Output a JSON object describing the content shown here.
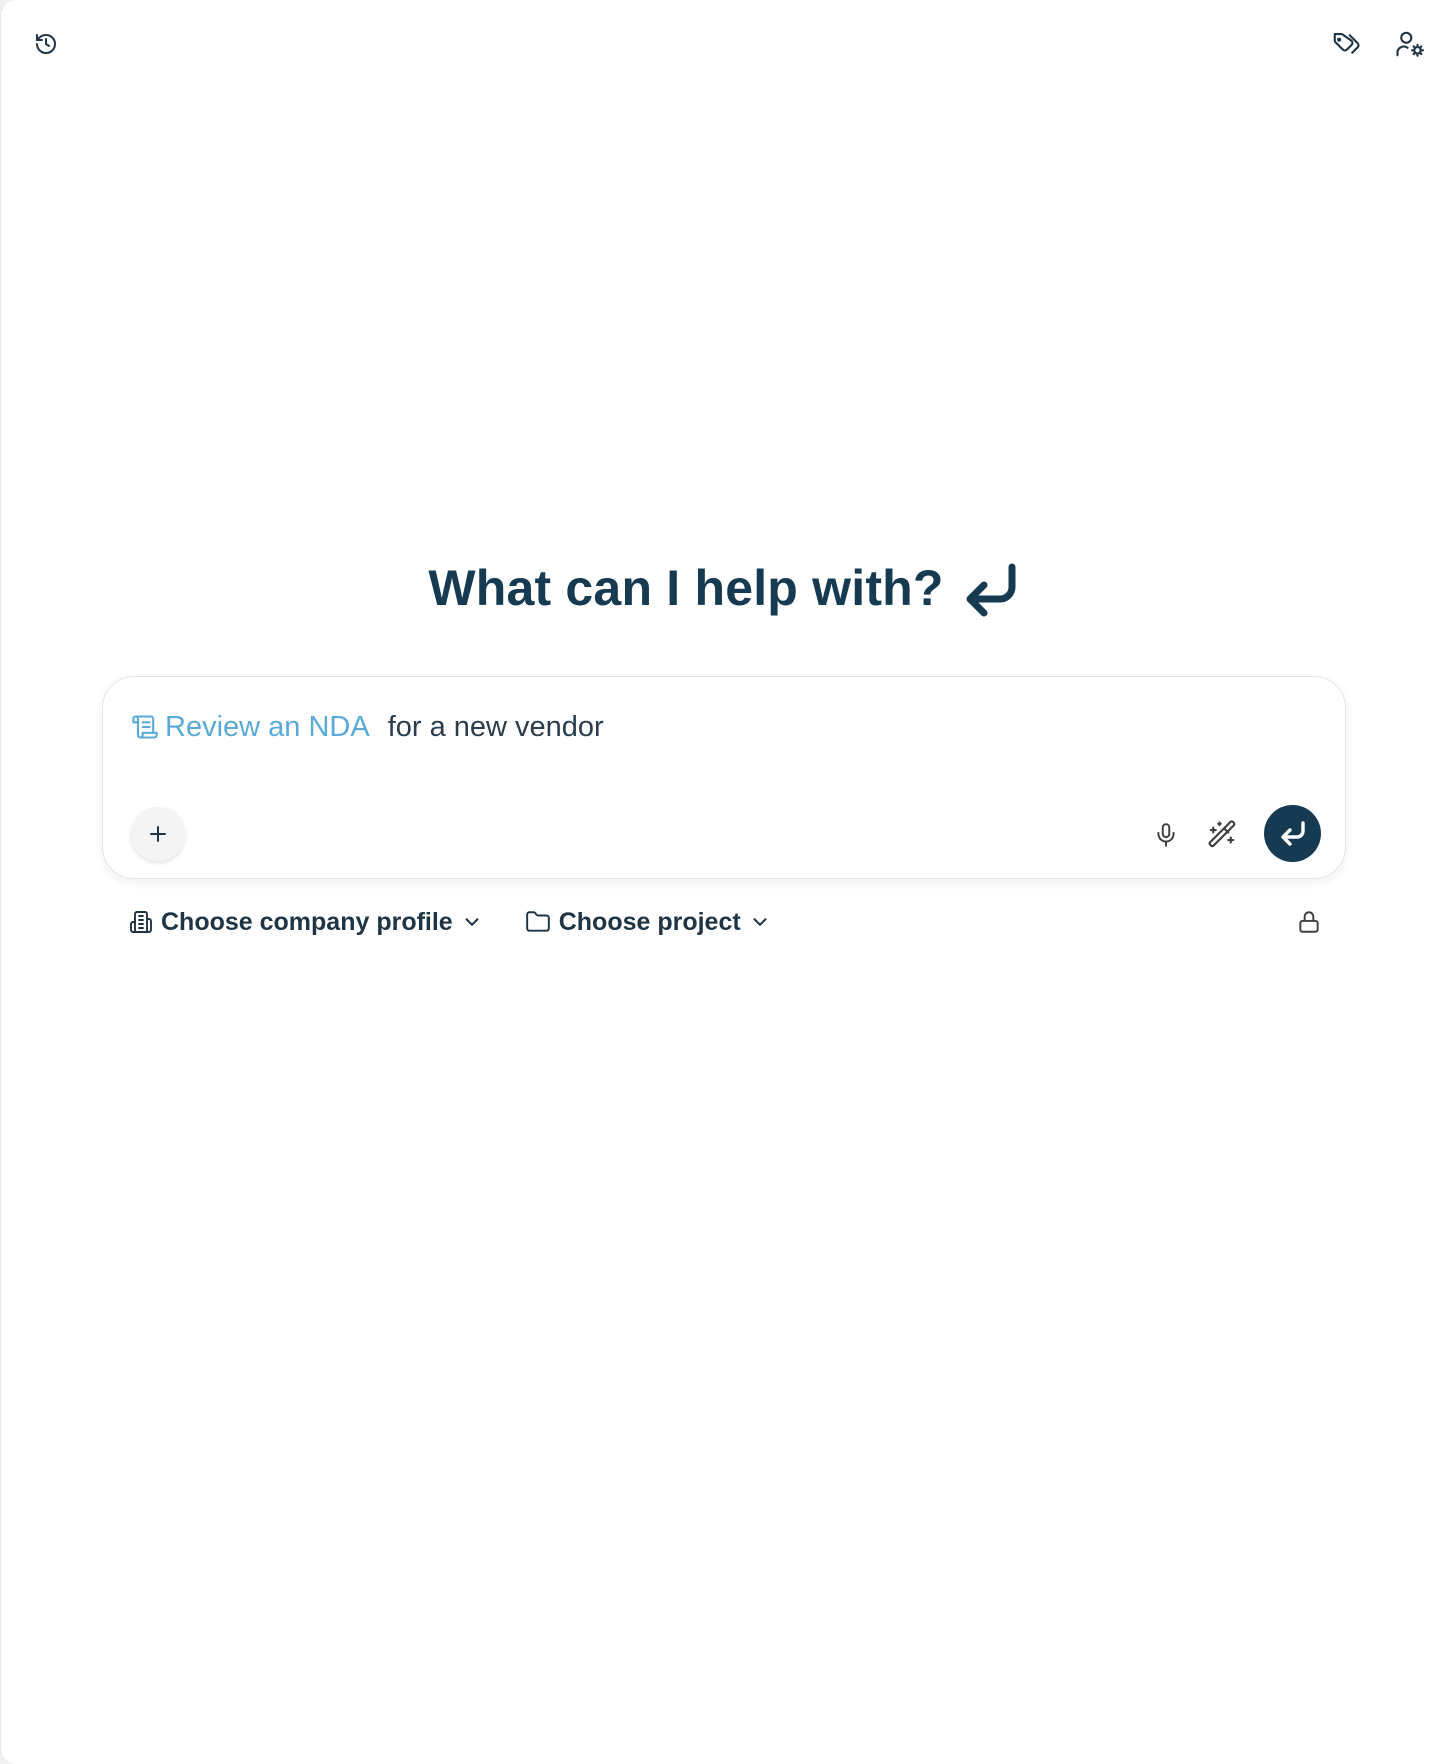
{
  "header": {
    "history_icon": "history-icon",
    "tags_icon": "tag-icon",
    "account_icon": "user-settings-icon"
  },
  "main": {
    "heading": "What can I help with?",
    "heading_icon": "return-arrow-icon"
  },
  "composer": {
    "chip_label": "Review an NDA",
    "chip_icon": "scroll-icon",
    "prompt_text": "for a new vendor",
    "add_icon": "plus-icon",
    "mic_icon": "microphone-icon",
    "magic_icon": "magic-wand-icon",
    "send_icon": "return-arrow-icon"
  },
  "selectors": {
    "company_label": "Choose company profile",
    "company_icon": "building-icon",
    "project_label": "Choose project",
    "project_icon": "folder-icon",
    "lock_icon": "lock-icon"
  },
  "colors": {
    "accent_navy": "#163a52",
    "chip_blue": "#5aaad8",
    "text_dark": "#1f3545"
  }
}
